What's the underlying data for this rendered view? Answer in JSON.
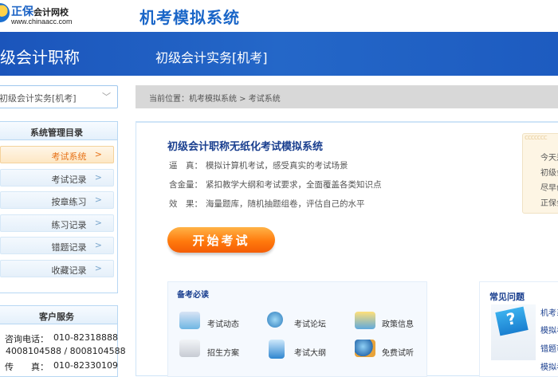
{
  "header": {
    "logo_brand": "正保",
    "logo_school": "会计网校",
    "logo_url": "www.chinaacc.com",
    "app_title": "机考模拟系统"
  },
  "banner": {
    "category": "级会计职称",
    "subject": "初级会计实务[机考]"
  },
  "subject_select": {
    "value": "初级会计实务[机考]"
  },
  "breadcrumb": {
    "text": "当前位置：机考模拟系统  >  考试系统"
  },
  "sidebar": {
    "title": "系统管理目录",
    "items": [
      {
        "label": "考试系统",
        "active": true
      },
      {
        "label": "考试记录"
      },
      {
        "label": "按章练习"
      },
      {
        "label": "练习记录"
      },
      {
        "label": "错题记录"
      },
      {
        "label": "收藏记录"
      }
    ]
  },
  "service": {
    "title": "客户服务",
    "phone_label": "咨询电话：",
    "phone": "010-82318888",
    "hotline": "4008104588 / 8008104588",
    "fax_label": "传　　真：",
    "fax": "010-82330109"
  },
  "main": {
    "title": "初级会计职称无纸化考试模拟系统",
    "features": [
      {
        "key": "逼　真：",
        "value": "模拟计算机考试，感受真实的考试场景"
      },
      {
        "key": "含金量：",
        "value": "紧扣教学大纲和考试要求，全面覆盖各类知识点"
      },
      {
        "key": "效　果：",
        "value": "海量题库，随机抽题组卷，评估自己的水平"
      }
    ],
    "start_button": "开始考试"
  },
  "notepad": {
    "lines": [
      "今天是",
      "初级会",
      "尽早创",
      "正保会"
    ]
  },
  "study": {
    "title": "备考必读",
    "links": [
      "考试动态",
      "考试论坛",
      "政策信息",
      "招生方案",
      "考试大纲",
      "免费试听"
    ]
  },
  "faq": {
    "title": "常见问题",
    "links": [
      "机考系",
      "模拟考",
      "错题可",
      "模拟考"
    ]
  }
}
